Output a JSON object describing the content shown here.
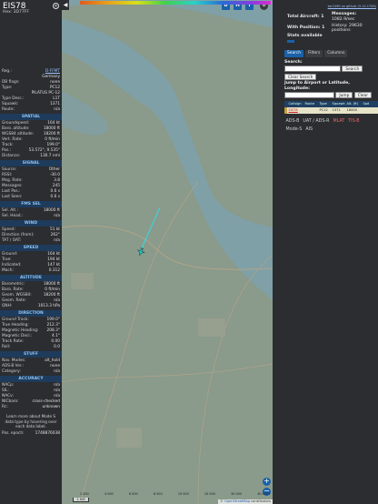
{
  "aircraft": {
    "callsign": "EIS78",
    "hex_line": "Hex: 3D77FF",
    "info": [
      {
        "k": "Reg.:",
        "v": "D-FFMT",
        "link": true
      },
      {
        "k": "",
        "v": "Germany"
      },
      {
        "k": "DB flags:",
        "v": "none"
      },
      {
        "k": "Type:",
        "v": "PC12"
      },
      {
        "k": "",
        "v": "PILATUS PC-12"
      },
      {
        "k": "Type Desc.:",
        "v": "L1T"
      },
      {
        "k": "Squawk:",
        "v": "1371"
      },
      {
        "k": "Route:",
        "v": "n/a"
      }
    ]
  },
  "sections": [
    {
      "title": "SPATIAL",
      "rows": [
        {
          "k": "Groundspeed:",
          "v": "164 kt"
        },
        {
          "k": "Baro. altitude:",
          "v": "18000 ft"
        },
        {
          "k": "WGS84 altitude:",
          "v": "18200 ft"
        },
        {
          "k": "Vert. Rate:",
          "v": "0 ft/min"
        },
        {
          "k": "Track:",
          "v": "199.0°"
        },
        {
          "k": "Pos.:",
          "v": "53.572°, 9.535°"
        },
        {
          "k": "Distance:",
          "v": "130.7 nmi"
        }
      ]
    },
    {
      "title": "SIGNAL",
      "rows": [
        {
          "k": "Source:",
          "v": "Other"
        },
        {
          "k": "RSSI:",
          "v": "-30.0"
        },
        {
          "k": "Msg. Rate:",
          "v": "3.8"
        },
        {
          "k": "Messages:",
          "v": "245"
        },
        {
          "k": "Last Pos.:",
          "v": "0.6 s"
        },
        {
          "k": "Last Seen:",
          "v": "0.6 s"
        }
      ]
    },
    {
      "title": "FMS SEL",
      "rows": [
        {
          "k": "Sel. Alt.:",
          "v": "18000 ft"
        },
        {
          "k": "Sel. Head.:",
          "v": "n/a"
        }
      ]
    },
    {
      "title": "WIND",
      "rows": [
        {
          "k": "Speed:",
          "v": "51 kt"
        },
        {
          "k": "Direction (from):",
          "v": "262°"
        },
        {
          "k": "TAT / OAT:",
          "v": "n/a"
        }
      ]
    },
    {
      "title": "SPEED",
      "rows": [
        {
          "k": "Ground:",
          "v": "164 kt"
        },
        {
          "k": "True:",
          "v": "194 kt"
        },
        {
          "k": "Indicated:",
          "v": "147 kt"
        },
        {
          "k": "Mach:",
          "v": "0.312"
        }
      ]
    },
    {
      "title": "ALTITUDE",
      "rows": [
        {
          "k": "Barometric:",
          "v": "18000 ft"
        },
        {
          "k": "Baro. Rate:",
          "v": "0 ft/min"
        },
        {
          "k": "Geom. WGS84:",
          "v": "18200 ft"
        },
        {
          "k": "Geom. Rate:",
          "v": "n/a"
        },
        {
          "k": "QNH:",
          "v": "1013.3 hPa"
        }
      ]
    },
    {
      "title": "DIRECTION",
      "rows": [
        {
          "k": "Ground Track:",
          "v": "199.0°"
        },
        {
          "k": "True Heading:",
          "v": "212.3°"
        },
        {
          "k": "Magnetic Heading:",
          "v": "208.3°"
        },
        {
          "k": "Magnetic Decl.:",
          "v": "4.1°"
        },
        {
          "k": "Track Rate:",
          "v": "0.00"
        },
        {
          "k": "Roll:",
          "v": "0.0"
        }
      ]
    },
    {
      "title": "STUFF",
      "rows": [
        {
          "k": "Nav. Modes:",
          "v": "alt_hold"
        },
        {
          "k": "ADS-B Ver.:",
          "v": "none"
        },
        {
          "k": "Category:",
          "v": "n/a"
        }
      ]
    },
    {
      "title": "ACCURACY",
      "rows": [
        {
          "k": "NACp:",
          "v": "n/a"
        },
        {
          "k": "SIL:",
          "v": "n/a"
        },
        {
          "k": "NACv:",
          "v": "n/a"
        },
        {
          "k": "NICbaro:",
          "v": "cross-checked"
        },
        {
          "k": "Rc:",
          "v": "unknown"
        }
      ]
    }
  ],
  "left_note": "Learn more about Mode S data type by hovering over each data label.",
  "pos_epoch": {
    "k": "Pos. epoch:",
    "v": "1748876038"
  },
  "map": {
    "top_buttons": [
      "U",
      "H",
      "T"
    ],
    "side_buttons": [
      "O",
      "K",
      "L",
      "M",
      "V",
      "P",
      "I",
      "R",
      "F"
    ],
    "altitude_labels": [
      "2 000",
      "4 000",
      "6 000",
      "8 000",
      "10 000",
      "20 000",
      "30 000",
      "40 000+"
    ],
    "scale_label": "1 NM",
    "attribution_prefix": "© ",
    "attribution_link": "OpenStreetMap",
    "attribution_suffix": " contributors",
    "colors": {
      "water": "#7fa0a6",
      "land": "#8a9a8b",
      "track": "#40d4d8"
    }
  },
  "right_panel": {
    "version_link": "tar1090 on github (3.14.1756)",
    "total_aircraft": "Total Aircraft: 1",
    "with_position": "With Position: 1",
    "stats_label": "Stats available",
    "messages": "Messages:",
    "messages_rate": "1082.9/sec",
    "history": "History: 29630",
    "history2": "positions",
    "tabs": [
      "Search",
      "Filters",
      "Columns"
    ],
    "search_label": "Search:",
    "search_button": "Search",
    "clear_search": "Clear Search",
    "jump_label": "Jump to Airport or Latitude,",
    "jump_label2": "Longitude:",
    "jump_button": "Jump",
    "clear_button": "Clear",
    "table_headers": [
      "Callsign",
      "Route",
      "Type",
      "Squawk",
      "Alt. (ft)",
      "Spd"
    ],
    "table_row": {
      "callsign": "EIS78",
      "type": "PC12",
      "squawk": "1371",
      "alt": "18000"
    },
    "badges_row1": [
      "ADS-B",
      "UAT / ADS-R",
      "MLAT",
      "TIS-B"
    ],
    "badges_row2": [
      "Mode-S",
      "AIS"
    ]
  }
}
